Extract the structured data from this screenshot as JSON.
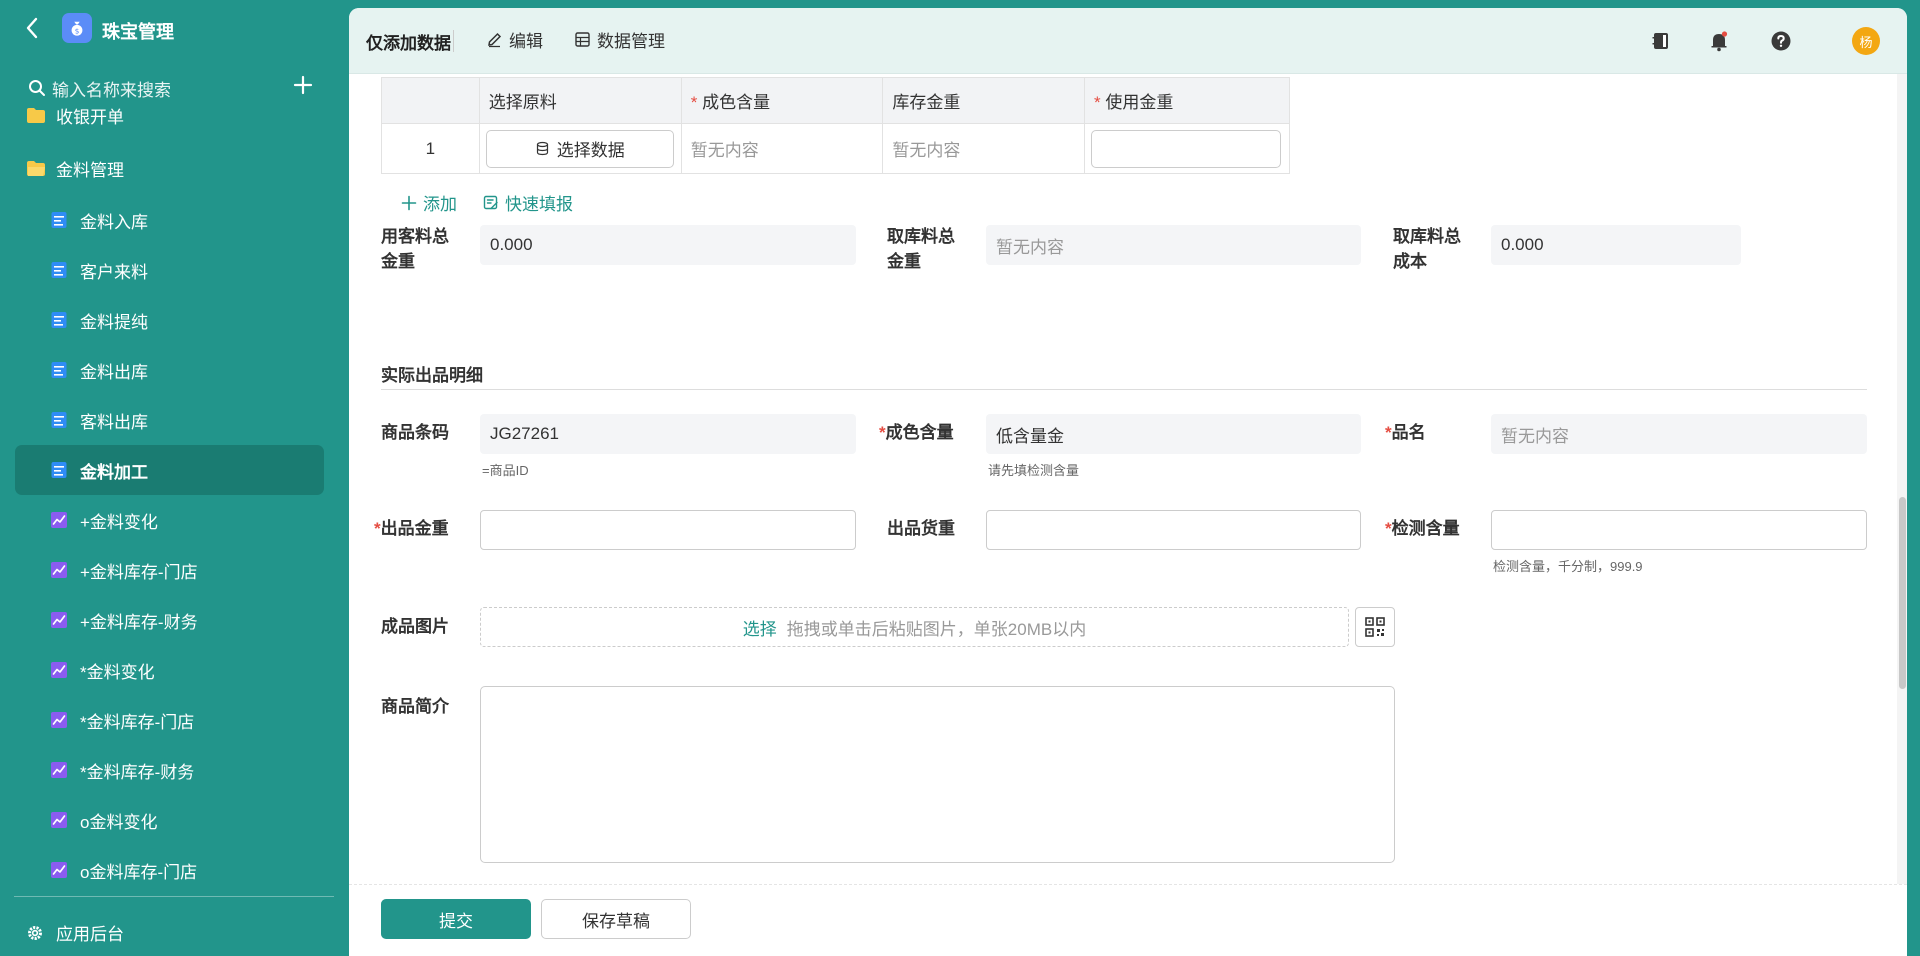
{
  "sidebar": {
    "app_title": "珠宝管理",
    "search_placeholder": "输入名称来搜索",
    "partial_item": "收银开单",
    "folder_label": "金料管理",
    "items": [
      {
        "label": "金料入库",
        "icon": "form-icon"
      },
      {
        "label": "客户来料",
        "icon": "form-icon"
      },
      {
        "label": "金料提纯",
        "icon": "form-icon"
      },
      {
        "label": "金料出库",
        "icon": "form-icon"
      },
      {
        "label": "客料出库",
        "icon": "form-icon"
      },
      {
        "label": "金料加工",
        "icon": "form-icon",
        "active": true
      },
      {
        "label": "+金料变化",
        "icon": "chart-icon"
      },
      {
        "label": "+金料库存-门店",
        "icon": "chart-icon"
      },
      {
        "label": "+金料库存-财务",
        "icon": "chart-icon"
      },
      {
        "label": "*金料变化",
        "icon": "chart-icon"
      },
      {
        "label": "*金料库存-门店",
        "icon": "chart-icon"
      },
      {
        "label": "*金料库存-财务",
        "icon": "chart-icon"
      },
      {
        "label": "o金料变化",
        "icon": "chart-icon"
      },
      {
        "label": "o金料库存-门店",
        "icon": "chart-icon"
      }
    ],
    "bottom_label": "应用后台"
  },
  "toolbar": {
    "title": "仅添加数据",
    "edit_label": "编辑",
    "data_manage_label": "数据管理",
    "avatar_text": "杨"
  },
  "material_table": {
    "headers": [
      "",
      "选择原料",
      "成色含量",
      "库存金重",
      "使用金重"
    ],
    "required": [
      false,
      false,
      true,
      false,
      true
    ],
    "row": {
      "index": "1",
      "select_label": "选择数据",
      "purity": "暂无内容",
      "stock_weight": "暂无内容",
      "use_weight": ""
    }
  },
  "actions": {
    "add_label": "添加",
    "quick_fill_label": "快速填报"
  },
  "totals": {
    "customer_total_label": "用客料总金重",
    "customer_total_value": "0.000",
    "stock_total_label": "取库料总金重",
    "stock_total_value": "暂无内容",
    "stock_cost_label": "取库料总成本",
    "stock_cost_value": "0.000"
  },
  "output_section": {
    "title": "实际出品明细",
    "barcode_label": "商品条码",
    "barcode_value": "JG27261",
    "barcode_hint": "=商品ID",
    "purity_label": "成色含量",
    "purity_value": "低含量金",
    "purity_hint": "请先填检测含量",
    "name_label": "品名",
    "name_value": "暂无内容",
    "out_weight_label": "出品金重",
    "out_goods_weight_label": "出品货重",
    "test_purity_label": "检测含量",
    "test_purity_hint": "检测含量，千分制，999.9",
    "image_label": "成品图片",
    "upload_pick": "选择",
    "upload_hint": "拖拽或单击后粘贴图片，单张20MB以内",
    "intro_label": "商品简介"
  },
  "footer": {
    "submit_label": "提交",
    "draft_label": "保存草稿"
  },
  "colors": {
    "brand": "#22958b",
    "brand_dark": "#1a7c72",
    "required": "#e54d42",
    "avatar": "#f3a712"
  }
}
